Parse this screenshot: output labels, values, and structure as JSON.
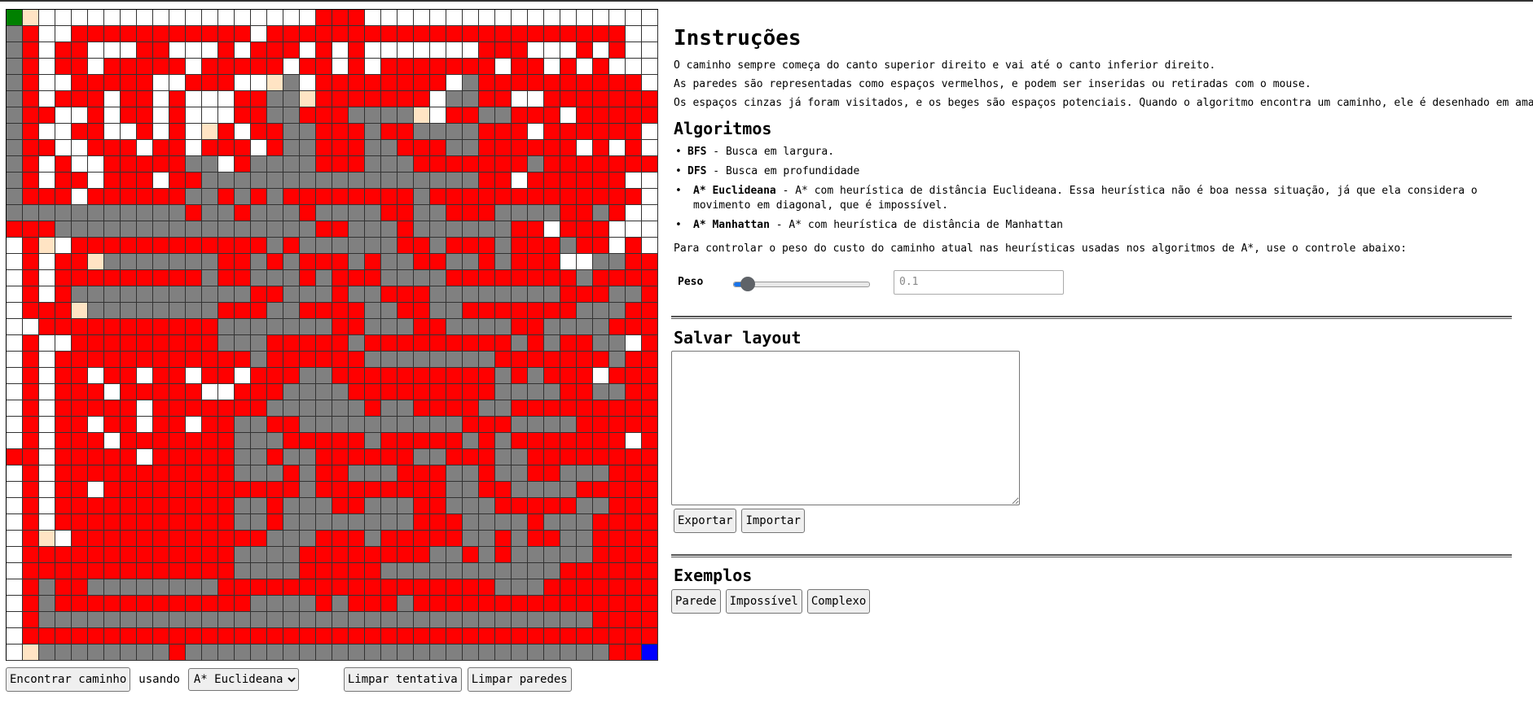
{
  "grid": {
    "rows": 40,
    "cols": 40,
    "colors": {
      "open": "#ffffff",
      "wall": "#ff0000",
      "visited": "#808080",
      "potential": "#ffe4c4",
      "start": "#008000",
      "end": "#0000ff"
    },
    "legend": {
      ".": "open",
      "R": "wall",
      "G": "visited",
      "B": "potential",
      "S": "start",
      "E": "end"
    },
    "cells": [
      "SB.................RRR..................",
      "GR..RRRRRRRRRRR.RRRRRRRRRRRRRRRRRRRRRR..",
      "GR.RR...RR...R.RRR.R.R.......RRR...R.R..",
      "GR.RR.RRRRR.RRRRR.RR.R.RRRRRRR.RR.R.R...",
      "GR..RRRRR..RRR..BG.RRRRRRRR.GRRRRRRRRRR.",
      "GR.RRR.RR.R...RRGGBRRRRRRR.GGRR..RRRRRRR",
      "GRR..R.RR.R...RRGGRRRGGGGB.RRGGRRR.RRRRR",
      "GR..RR..R.R.BR.RRGGRRRGRRGGGGRRR.RRRRRR.",
      "GRR..RRR.RR.RRR.RGGRRRGGRRRGGRRRRRR.R.R.",
      "GR.R..RRRRRGG.RGGGGRRRGGGRRRRRRRGRRRRRRR",
      "GR.RR.RRR.RRGGGGGGGGGGGGGGGGGRR.RRRRRR..",
      "GRRR.RRRRRRGGRGRGRRRRRRRRGRRRRRRRRRRRRR.",
      "GGGGGGGGGGGRGGRGGGRGGGGRRGGRRRGGGGRRGR..",
      "RRRGGGGGGGGGGGGGGGGRRGGGRGGGGGGRR.RRR...",
      ".RB.RRRRRRRRRRRRGRGGGGGGRRGRRRGRRRGRR.R.",
      ".R.RRBGGGGGGGRRGRGRRRGRGGRRGGRGRRR..GGRR",
      ".R.RRRRRRRRRGRRGGGRGRRRGGGGRRRRRRRRGRRRR",
      ".R.RGGGGGGGGGGGRRGGGRGGRRRGGGGGGGGRRRGGR",
      ".RRRBGGGGGGGGRRRGGRRRRGGRRGGRRRRRRRGGGRR",
      "..RRRRRRRRRRRGGGGGGGRRGGGRRGGGGRRGGGGRRR",
      ".R..RRRRRRRRRGGGRRRRRGRRRRRRRRRGRGRRGG.R",
      ".R.RRRRRRRRRRRRGRRRRRRGGGGGGGGRRRRRRRGRR",
      ".R.RR.RR.RR.RR.RRRGGRRRRRRRRRRGRGRRR.RRR",
      ".R.RRR.RRRRR..RRRGGGGRRRRRRRRRGGGGRRGGRR",
      ".R.RRRRR.RRRRRRRGGGGGGRGGRRRRGGRRRRRRRRR",
      ".R.RR.RR.RR.RRGGRRGGGGGGGGGGRRRGGGGRRRRR",
      ".R.RRR.RRRRRRRGGGRRRRRGRRRRRGRGRRRRRRR.R",
      "RR.RRRRR.RRRRRGGRGGRRRRRRGGRRRGGRRRRRRRR",
      ".R.RRRRRRRRRRRGGGRGRRGGGRRRGGRGGRRGGGRRR",
      ".R.RR.RRRRRRRRRRRRGRRRRRRRRGGRRGGGGRRRRR",
      ".R.RRRRRRRRRRRGGRGGGRRGGGRRGGGRRRRRGGRRR",
      ".R.RRRRRRRRRRRGGRGGGGGGGGRRRGGGGRGGGRRRR",
      ".RB.RRRRRRRRRRRRGGGRRRGRRRRRGGRGRRGGRRRR",
      ".RRRRRRRRRRRRRGGGGRRRRRRRRGGRGRGGGGGRRRR",
      ".RRRRRRRRRRRRRGGGGRRRRRGGGGGGGGGGGRRRRRR",
      ".RGRRGGGGGGGGRRRRRRRRRRRRRRRRRGGGRRRRRRR",
      ".RGRRRRRRRRRRRRGGGGRGRRRGRRRRRRRRRRRRRRR",
      ".RGGGGGGGGGGGGGGGGGGGGGGGGGGGGGGGGGGRRRR",
      ".RRRRRRRRRRRRRRRRRRRRRRRRRRRRRRRRRRRRRRR",
      ".BGGGGGGGGRGGGGGGGGGGGGGGGGGGGGGGGGGGRRE"
    ]
  },
  "controls": {
    "find_label": "Encontrar caminho",
    "using_label": "usando",
    "algorithm_selected": "A* Euclideana",
    "algorithm_options": [
      "BFS",
      "DFS",
      "A* Euclideana",
      "A* Manhattan"
    ],
    "clear_attempt_label": "Limpar tentativa",
    "clear_walls_label": "Limpar paredes"
  },
  "instructions": {
    "title": "Instruções",
    "p1": "O caminho sempre começa do canto superior direito e vai até o canto inferior direito.",
    "p2": "As paredes são representadas como espaços vermelhos, e podem ser inseridas ou retiradas com o mouse.",
    "p3": "Os espaços cinzas já foram visitados, e os beges são espaços potenciais. Quando o algoritmo encontra um caminho, ele é desenhado em amarelo."
  },
  "algorithms": {
    "title": "Algoritmos",
    "items": [
      {
        "name": "BFS",
        "desc": " - Busca em largura."
      },
      {
        "name": "DFS",
        "desc": " - Busca em profundidade"
      },
      {
        "name": "A* Euclideana",
        "desc": " - A* com heurística de distância Euclideana. Essa heurística não é boa nessa situação, já que ela considera o movimento em diagonal, que é impossível."
      },
      {
        "name": "A* Manhattan",
        "desc": " - A* com heurística de distância de Manhattan"
      }
    ],
    "weight_intro": "Para controlar o peso do custo do caminho atual nas heurísticas usadas nos algoritmos de A*, use o controle abaixo:",
    "weight_label": "Peso",
    "weight_value": "0.1",
    "weight_fraction": 0.1
  },
  "save": {
    "title": "Salvar layout",
    "textarea_value": "",
    "export_label": "Exportar",
    "import_label": "Importar"
  },
  "examples": {
    "title": "Exemplos",
    "buttons": [
      "Parede",
      "Impossível",
      "Complexo"
    ]
  }
}
